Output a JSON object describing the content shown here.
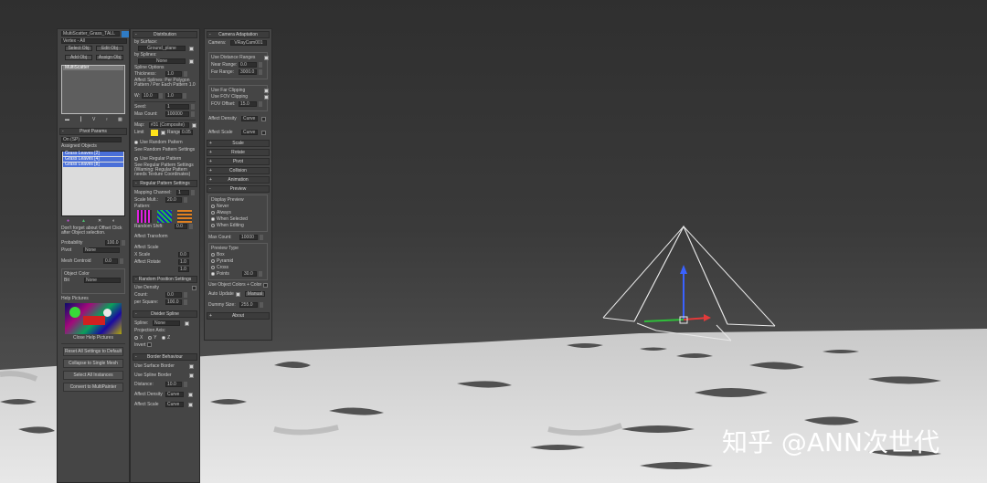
{
  "watermark": "知乎 @ANN次世代",
  "col1": {
    "title": "MultiScatter_Grass_TALL",
    "color": "#2f7bc4",
    "renderer": "Vertex - All",
    "btn_select": "Select Obj",
    "btn_edit": "Edit Obj",
    "btn_adda": "Add Obj",
    "btn_assign": "Assign Obj",
    "list_title": "MultiScatter",
    "tool_icons": [
      "toolbox-icon",
      "info-icon",
      "filter-icon",
      "help-icon",
      "gear-icon"
    ],
    "pivot_header": "Pivot Params",
    "pivot_mode": "On (SP)",
    "pivot_subtitle": "Assigned Objects",
    "pivot_items": [
      "Grass Leaves [2]",
      "Grass Leaves [4]",
      "Grass Leaves [8]"
    ],
    "pivot_note": "Don't forget about Offset Click after Object selection.",
    "prob_label": "Probability",
    "prob_value": "100.0",
    "pivot_label": "Pivot",
    "pivot_value": "None",
    "mesh_centroid_label": "Mesh Centroid",
    "mesh_centroid_value": "0.0",
    "obj_color_label": "Object Color",
    "obj_color_sub": "Bit",
    "obj_color_value": "None",
    "help_pictures_label": "Help Pictures",
    "close_help": "Close Help Pictures",
    "btn_reset": "Reset All Settings to Default",
    "btn_collapse": "Collapse to Single Mesh",
    "btn_select_all": "Select All Instances",
    "btn_convert": "Convert to MultiPainter"
  },
  "col2": {
    "distribution_header": "Distribution",
    "by_surface_label": "by Surface:",
    "surface_value": "Ground_plane",
    "by_splines_label": "by Splines:",
    "splines_value": "None",
    "spline_options": "Spline Options",
    "thickness_label": "Thickness:",
    "thickness_value": "1.0",
    "object_splines_note": "Affect Splines: Per Polygon Pattern / Per Each Pattern 1.0",
    "w_label": "W:",
    "w_value": "10.0",
    "h_value": "1.0",
    "seed_label": "Seed:",
    "seed_value": "1",
    "max_count_label": "Max Count:",
    "max_count_value": "100000",
    "map_label": "Map:",
    "map_value": "#31 (Composite)",
    "limit_label": "Limit",
    "range_label": "Range",
    "range_value": "0.05",
    "use_random_pattern": "Use Random Pattern",
    "see_random_pattern": "See Random Pattern Settings",
    "use_regular_pattern": "Use Regular Pattern",
    "regular_note": "See Regular Pattern Settings (Warning: Regular Pattern needs Texture Coordinates)",
    "regular_header": "Regular Pattern Settings",
    "mapping_channel_label": "Mapping Channel:",
    "mapping_channel_value": "1",
    "scale_mult_label": "Scale Mult.:",
    "scale_mult_value": "20.0",
    "pattern_label": "Pattern:",
    "random_shift_label": "Random Shift:",
    "random_shift_value": "0.0",
    "affect_transform_label": "Affect Transform",
    "affect_scale_label": "Affect Scale",
    "x_scale_label": "X Scale",
    "affect_rotate_label": "Affect Rotate",
    "x_value": "0.0",
    "y_value": "1.0",
    "z_value": "1.0",
    "random_header": "Random Position Settings",
    "use_density_label": "Use Density",
    "count_label": "Count:",
    "count_value": "0.0",
    "per_square_label": "per Square:",
    "per_square_value": "100.0",
    "divider_header": "Divider Spline",
    "spline_label": "Spline:",
    "spline_value": "None",
    "projection_axis_label": "Projection Axis:",
    "axis_x": "X",
    "axis_y": "Y",
    "axis_z": "Z",
    "invert_label": "Invert",
    "border_header": "Border Behaviour",
    "use_surface_border": "Use Surface Border",
    "use_spline_border": "Use Spline Border",
    "distance_label": "Distance:",
    "distance_value": "10.0",
    "affect_density_label": "Affect Density",
    "affect_density_value": "Curve",
    "affect_scale_label2": "Affect Scale",
    "affect_scale_value2": "Curve"
  },
  "col3": {
    "camera_header": "Camera Adaptation",
    "camera_label": "Camera:",
    "camera_value": "VRayCam001",
    "use_distance_ranges": "Use Distance Ranges",
    "near_range_label": "Near Range:",
    "near_range_value": "0.0",
    "far_range_label": "Far Range:",
    "far_range_value": "3000.0",
    "use_far_clipping": "Use Far Clipping",
    "use_fov_clipping": "Use FOV Clipping",
    "fov_offset_label": "FOV Offset:",
    "fov_offset_value": "15.0",
    "affect_density_label": "Affect Density",
    "affect_density_value": "Curve",
    "affect_scale_label": "Affect Scale",
    "affect_scale_value": "Curve",
    "rollouts": [
      "Scale",
      "Rotate",
      "Pivot",
      "Collision",
      "Animation"
    ],
    "preview_header": "Preview",
    "display_preview": "Display Preview",
    "preview_options": [
      "Never",
      "Always",
      "When Selected",
      "When Editing"
    ],
    "max_count_label": "Max Count:",
    "max_count_value": "10000",
    "preview_type_label": "Preview Type",
    "preview_types": [
      "Box",
      "Pyramid",
      "Cross",
      "Points"
    ],
    "points_value": "30.0",
    "use_object_color": "Use Object Colors + Color",
    "auto_update_label": "Auto Update",
    "update_btn": "Manual",
    "dummy_size_label": "Dummy Size:",
    "dummy_size_value": "255.0",
    "about_header": "About"
  },
  "colors": {
    "panel": "#454545",
    "selection": "#4a6fd8",
    "title_accent": "#2f7bc4"
  }
}
